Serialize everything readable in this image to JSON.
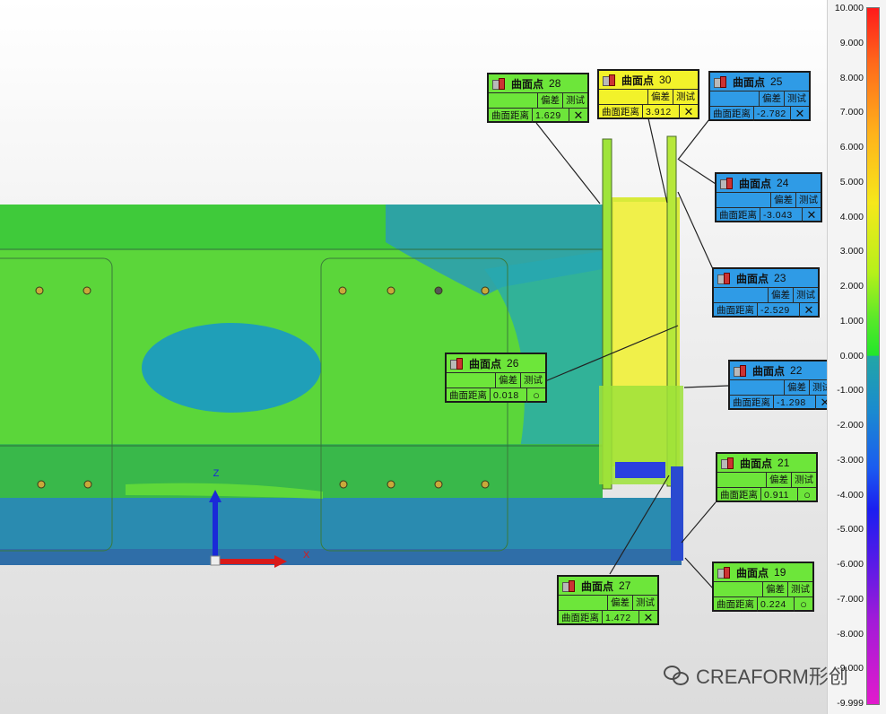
{
  "legend": {
    "ticks": [
      "10.000",
      "9.000",
      "8.000",
      "7.000",
      "6.000",
      "5.000",
      "4.000",
      "3.000",
      "2.000",
      "1.000",
      "0.000",
      "-1.000",
      "-2.000",
      "-3.000",
      "-4.000",
      "-5.000",
      "-6.000",
      "-7.000",
      "-8.000",
      "-9.000",
      "-9.999"
    ]
  },
  "axes": {
    "z_label": "Z",
    "x_label": "X"
  },
  "callout_headers": {
    "deviation": "偏差",
    "test": "测试",
    "row_label": "曲面距离"
  },
  "callouts": [
    {
      "id": "c28",
      "title": "曲面点",
      "number": "28",
      "value": "1.629",
      "status": "✕",
      "color": "#6de63a"
    },
    {
      "id": "c30",
      "title": "曲面点",
      "number": "30",
      "value": "3.912",
      "status": "✕",
      "color": "#f2f22a"
    },
    {
      "id": "c25",
      "title": "曲面点",
      "number": "25",
      "value": "-2.782",
      "status": "✕",
      "color": "#2f9be6"
    },
    {
      "id": "c24",
      "title": "曲面点",
      "number": "24",
      "value": "-3.043",
      "status": "✕",
      "color": "#2f9be6"
    },
    {
      "id": "c23",
      "title": "曲面点",
      "number": "23",
      "value": "-2.529",
      "status": "✕",
      "color": "#2f9be6"
    },
    {
      "id": "c26",
      "title": "曲面点",
      "number": "26",
      "value": "0.018",
      "status": "○",
      "color": "#6de63a"
    },
    {
      "id": "c22",
      "title": "曲面点",
      "number": "22",
      "value": "-1.298",
      "status": "✕",
      "color": "#2f9be6"
    },
    {
      "id": "c21",
      "title": "曲面点",
      "number": "21",
      "value": "0.911",
      "status": "○",
      "color": "#6de63a"
    },
    {
      "id": "c27",
      "title": "曲面点",
      "number": "27",
      "value": "1.472",
      "status": "✕",
      "color": "#6de63a"
    },
    {
      "id": "c19",
      "title": "曲面点",
      "number": "19",
      "value": "0.224",
      "status": "○",
      "color": "#6de63a"
    }
  ],
  "watermark": {
    "text": "CREAFORM形创"
  }
}
